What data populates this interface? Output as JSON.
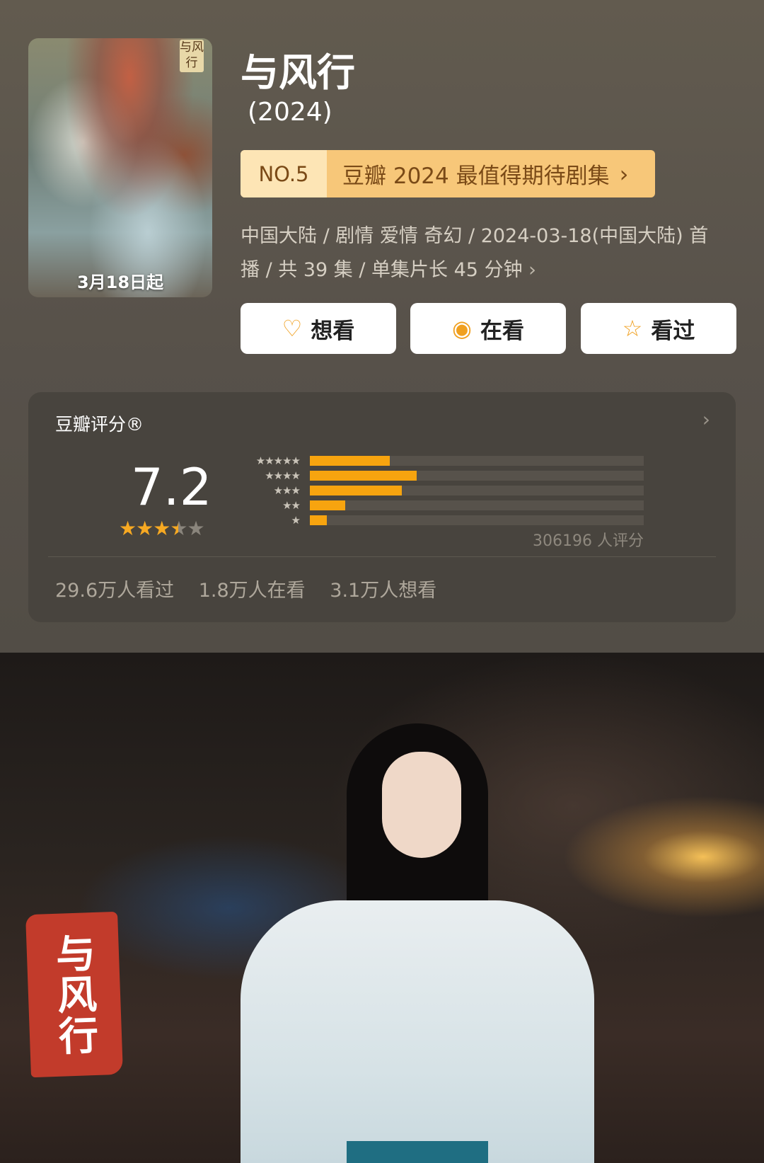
{
  "colors": {
    "accent": "#f7a922",
    "rank_bg": "#f7c779",
    "rank_no_bg": "#fde5b5",
    "card_bg": "#48443e"
  },
  "poster": {
    "date_label": "3月18日起",
    "seal_text": "与风行"
  },
  "title": "与风行",
  "year": "(2024)",
  "rank": {
    "number": "NO.5",
    "label": "豆瓣 2024 最值得期待剧集",
    "chevron": "›"
  },
  "meta": {
    "line1": "中国大陆 / 剧情 爱情 奇幻 / 2024-03-18(中国大陆) 首",
    "line2": "播 / 共 39 集 / 单集片长 45 分钟",
    "chevron": "›"
  },
  "actions": [
    {
      "label": "想看",
      "icon": "heart-plus-icon"
    },
    {
      "label": "在看",
      "icon": "target-icon"
    },
    {
      "label": "看过",
      "icon": "star-outline-icon"
    }
  ],
  "rating": {
    "title": "豆瓣评分®",
    "score": "7.2",
    "stars_value": 3.5,
    "distribution": [
      {
        "stars": "★★★★★",
        "fraction": 0.24
      },
      {
        "stars": "★★★★",
        "fraction": 0.32
      },
      {
        "stars": "★★★",
        "fraction": 0.275
      },
      {
        "stars": "★★",
        "fraction": 0.105
      },
      {
        "stars": "★",
        "fraction": 0.05
      }
    ],
    "count": "306196 人评分",
    "watched": "29.6万人看过",
    "watching": "1.8万人在看",
    "want": "3.1万人想看"
  },
  "photo": {
    "logo_text": "与风行"
  }
}
